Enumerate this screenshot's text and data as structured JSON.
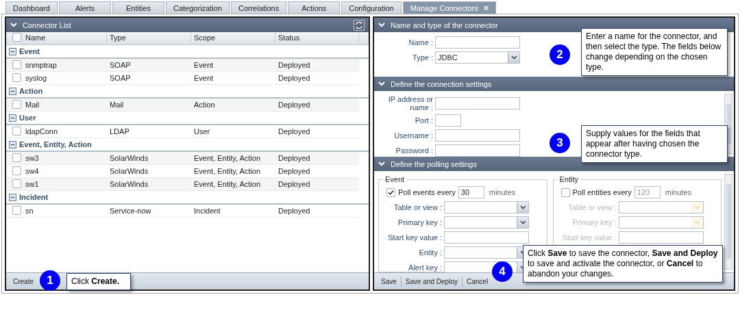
{
  "tabs": [
    {
      "label": "Dashboard",
      "selected": false
    },
    {
      "label": "Alerts",
      "selected": false
    },
    {
      "label": "Entities",
      "selected": false
    },
    {
      "label": "Categorization",
      "selected": false
    },
    {
      "label": "Correlations",
      "selected": false
    },
    {
      "label": "Actions",
      "selected": false
    },
    {
      "label": "Configuration",
      "selected": false
    },
    {
      "label": "Manage Connectors",
      "selected": true,
      "close": "×"
    }
  ],
  "connector_list": {
    "title": "Connector List",
    "select_all_checked": false,
    "columns": [
      "Name",
      "Type",
      "Scope",
      "Status"
    ],
    "groups": [
      {
        "name": "Event",
        "expanded": true,
        "rows": [
          {
            "name": "snmptrap",
            "type": "SOAP",
            "scope": "Event",
            "status": "Deployed",
            "checked": false
          },
          {
            "name": "syslog",
            "type": "SOAP",
            "scope": "Event",
            "status": "Deployed",
            "checked": false
          }
        ]
      },
      {
        "name": "Action",
        "expanded": true,
        "rows": [
          {
            "name": "Mail",
            "type": "Mail",
            "scope": "Action",
            "status": "Deployed",
            "checked": false
          }
        ]
      },
      {
        "name": "User",
        "expanded": true,
        "rows": [
          {
            "name": "ldapConn",
            "type": "LDAP",
            "scope": "User",
            "status": "Deployed",
            "checked": false
          }
        ]
      },
      {
        "name": "Event, Entity, Action",
        "expanded": true,
        "rows": [
          {
            "name": "sw3",
            "type": "SolarWinds",
            "scope": "Event, Entity, Action",
            "status": "Deployed",
            "checked": false
          },
          {
            "name": "sw4",
            "type": "SolarWinds",
            "scope": "Event, Entity, Action",
            "status": "Deployed",
            "checked": false
          },
          {
            "name": "sw1",
            "type": "SolarWinds",
            "scope": "Event, Entity, Action",
            "status": "Deployed",
            "checked": false
          }
        ]
      },
      {
        "name": "Incident",
        "expanded": true,
        "rows": [
          {
            "name": "sn",
            "type": "Service-now",
            "scope": "Incident",
            "status": "Deployed",
            "checked": false
          }
        ]
      }
    ],
    "toolbar": [
      "Create"
    ]
  },
  "name_section": {
    "title": "Name and type of the connector",
    "fields": [
      {
        "label": "Name :",
        "kind": "text"
      },
      {
        "label": "Type :",
        "kind": "select",
        "value": "JDBC"
      }
    ]
  },
  "connection_section": {
    "title": "Define the connection settings",
    "fields": [
      {
        "label": "IP address or name :",
        "kind": "text"
      },
      {
        "label": "Port :",
        "kind": "short"
      },
      {
        "label": "Username :",
        "kind": "text"
      },
      {
        "label": "Password :",
        "kind": "text"
      }
    ]
  },
  "polling_section": {
    "title": "Define the polling settings",
    "groups": [
      {
        "legend": "Event",
        "poll_label": "Poll events every",
        "checked": true,
        "interval": "30",
        "unit": "minutes",
        "disabled": false,
        "fields": [
          {
            "label": "Table or view :",
            "kind": "select"
          },
          {
            "label": "Primary key :",
            "kind": "select"
          },
          {
            "label": "Start key value :",
            "kind": "text"
          },
          {
            "label": "Entity :",
            "kind": "select"
          },
          {
            "label": "Alert key :",
            "kind": "select"
          }
        ]
      },
      {
        "legend": "Entity",
        "poll_label": "Poll entities every",
        "checked": false,
        "interval": "120",
        "unit": "minutes",
        "disabled": true,
        "fields": [
          {
            "label": "Table or view :",
            "kind": "select"
          },
          {
            "label": "Primary key :",
            "kind": "select"
          },
          {
            "label": "Start key value :",
            "kind": "text"
          }
        ]
      }
    ]
  },
  "form_toolbar": [
    "Save",
    "Save and Deploy",
    "Cancel"
  ],
  "callouts": [
    {
      "number": "1",
      "text": "Click **Create.**"
    },
    {
      "number": "2",
      "text": "Enter a name for the connector, and then select the type. The fields below change depending on the chosen type."
    },
    {
      "number": "3",
      "text": "Supply values for the fields that appear after having chosen the connector type."
    },
    {
      "number": "4",
      "text": "Click **Save** to save the connector, **Save and Deploy** to save and activate the connector, or **Cancel** to abandon your changes."
    }
  ]
}
